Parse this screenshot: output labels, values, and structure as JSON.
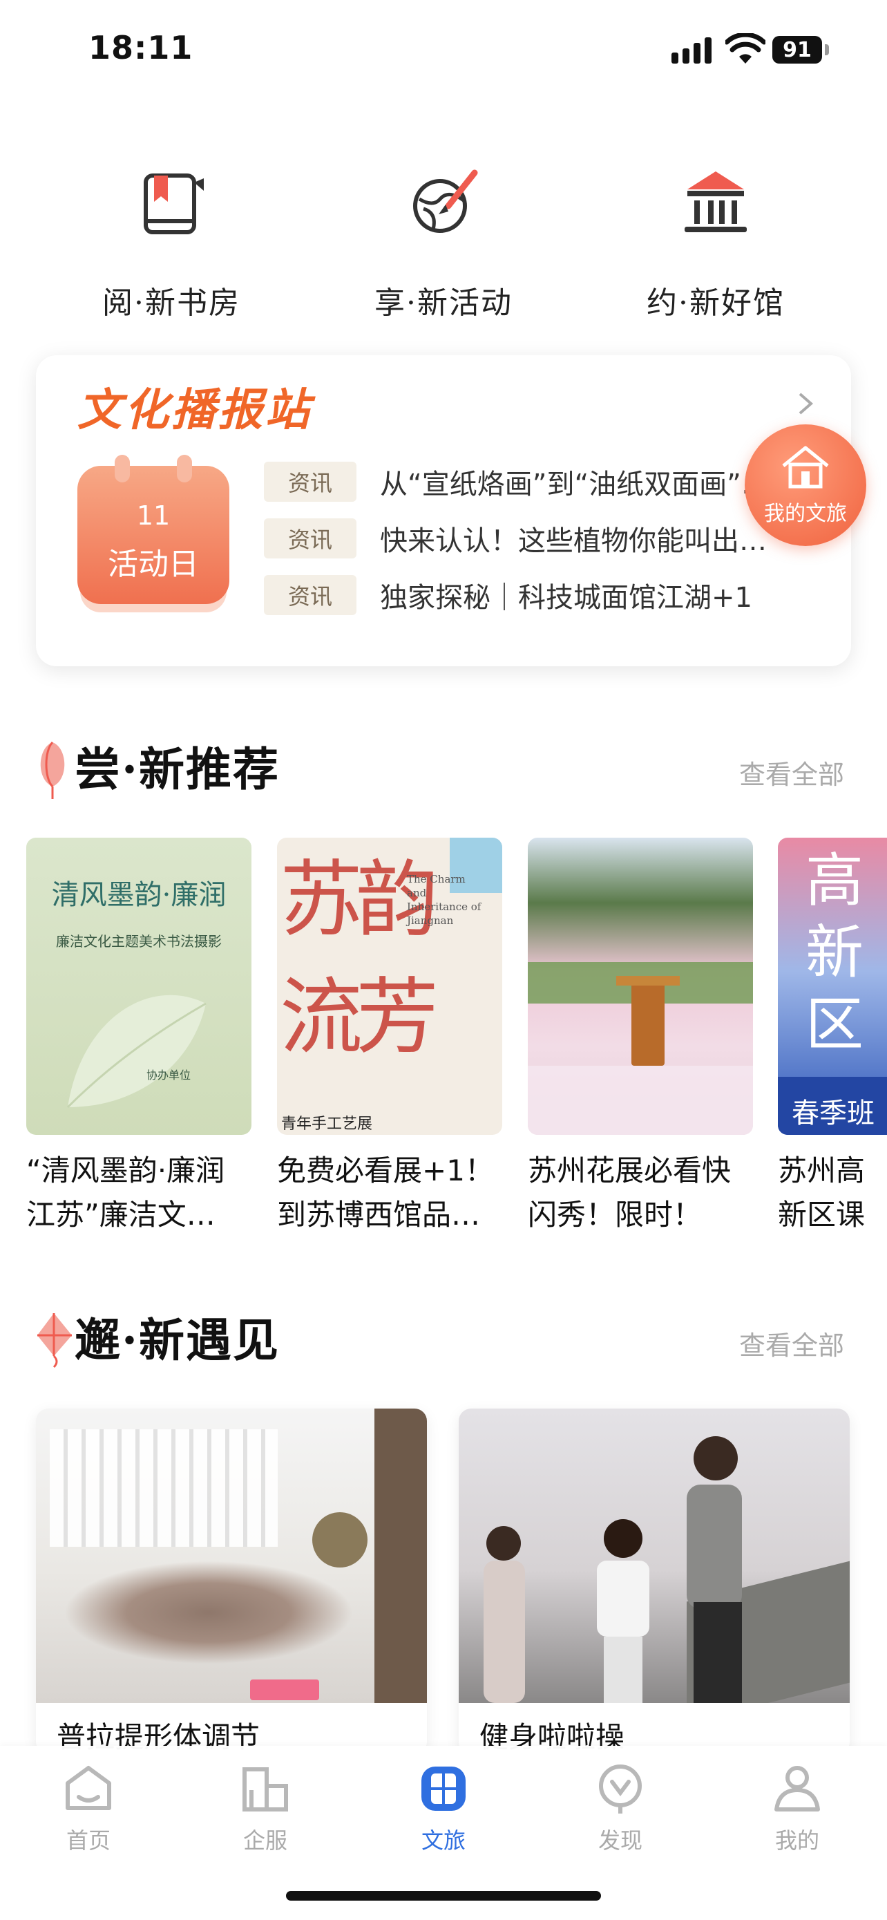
{
  "status_bar": {
    "time": "18:11",
    "battery": "91"
  },
  "quick_nav": [
    {
      "label": "阅·新书房",
      "icon": "book-bookmark-icon"
    },
    {
      "label": "享·新活动",
      "icon": "globe-brush-icon"
    },
    {
      "label": "约·新好馆",
      "icon": "museum-icon"
    }
  ],
  "broadcast": {
    "title": "文化播报站",
    "calendar": {
      "day": "11",
      "label": "活动日"
    },
    "news": [
      {
        "tag": "资讯",
        "text": "从“宣纸烙画”到“油纸双面画”…"
      },
      {
        "tag": "资讯",
        "text": "快来认认！这些植物你能叫出…"
      },
      {
        "tag": "资讯",
        "text": "独家探秘｜科技城面馆江湖+1"
      }
    ]
  },
  "float_button": {
    "label": "我的文旅"
  },
  "recommend": {
    "title": "尝·新推荐",
    "more": "查看全部",
    "items": [
      {
        "title": "“清风墨韵·廉润江苏”廉洁文…",
        "poster": {
          "headline": "清风墨韵·廉润",
          "sub": "廉洁文化主题美术书法摄影",
          "foot": "协办单位"
        }
      },
      {
        "title": "免费必看展+1！到苏博西馆品…",
        "poster": {
          "headline": "苏韵流芳",
          "sub": "The Charm and Inheritance of Jiangnan",
          "foot": "青年手工艺展"
        }
      },
      {
        "title": "苏州花展必看快闪秀！限时！",
        "poster": {}
      },
      {
        "title": "苏州高新区课堂春季班…",
        "poster": {
          "headline": "高新区",
          "foot": "春季班"
        }
      }
    ]
  },
  "encounter": {
    "title": "邂·新遇见",
    "more": "查看全部",
    "items": [
      {
        "title": "普拉提形体调节"
      },
      {
        "title": "健身啦啦操"
      }
    ]
  },
  "tab_bar": [
    {
      "label": "首页",
      "icon": "home-icon",
      "active": false
    },
    {
      "label": "企服",
      "icon": "buildings-icon",
      "active": false
    },
    {
      "label": "文旅",
      "icon": "culture-window-icon",
      "active": true
    },
    {
      "label": "发现",
      "icon": "discover-icon",
      "active": false
    },
    {
      "label": "我的",
      "icon": "profile-icon",
      "active": false
    }
  ],
  "colors": {
    "accent": "#f06628",
    "tab_active": "#2f6fe0",
    "tab_inactive": "#aaaaaa"
  }
}
